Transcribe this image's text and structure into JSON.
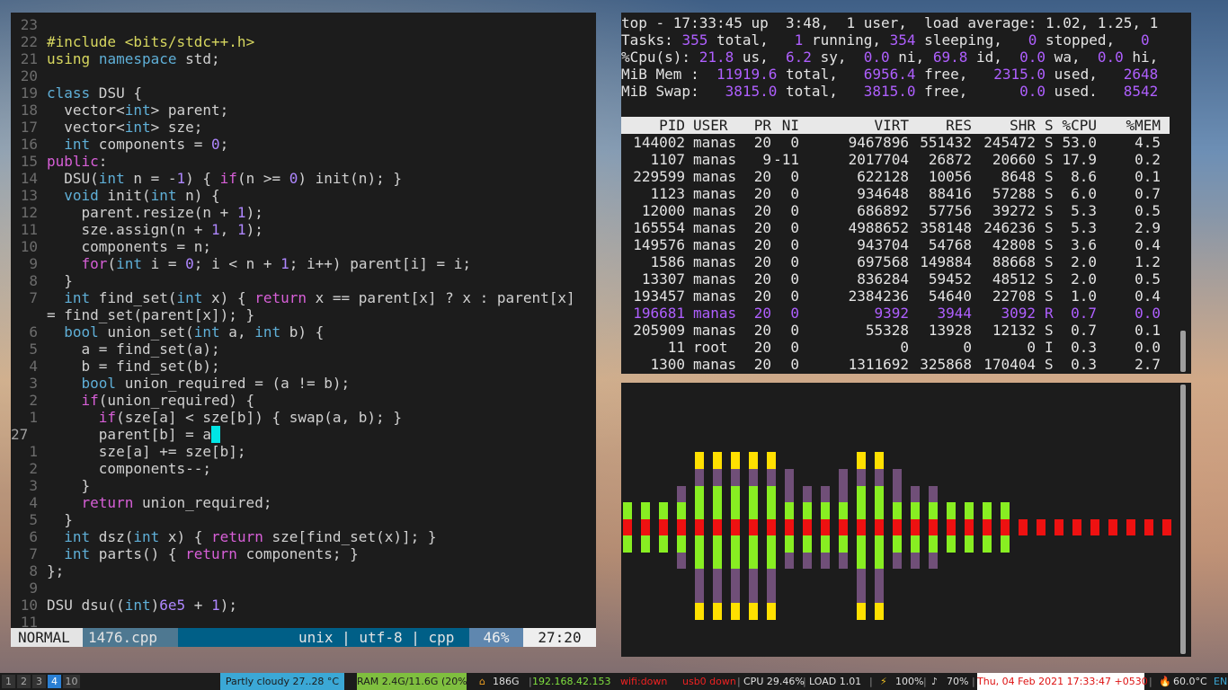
{
  "vim": {
    "lines": [
      {
        "n": "23",
        "t": ""
      },
      {
        "n": "22",
        "t": "<span class='pre'>#include</span> <span class='str'>&lt;bits/stdc++.h&gt;</span>"
      },
      {
        "n": "21",
        "t": "<span class='pre'>using</span> <span class='ty'>namespace</span> std;"
      },
      {
        "n": "20",
        "t": ""
      },
      {
        "n": "19",
        "t": "<span class='ty'>class</span> DSU {"
      },
      {
        "n": "18",
        "t": "  vector&lt;<span class='ty'>int</span>&gt; parent;"
      },
      {
        "n": "17",
        "t": "  vector&lt;<span class='ty'>int</span>&gt; sze;"
      },
      {
        "n": "16",
        "t": "  <span class='ty'>int</span> components = <span class='num'>0</span>;"
      },
      {
        "n": "15",
        "t": "<span class='kw'>public</span>:"
      },
      {
        "n": "14",
        "t": "  DSU(<span class='ty'>int</span> n = -<span class='num'>1</span>) { <span class='kw'>if</span>(n &gt;= <span class='num'>0</span>) init(n); }"
      },
      {
        "n": "13",
        "t": "  <span class='ty'>void</span> init(<span class='ty'>int</span> n) {"
      },
      {
        "n": "12",
        "t": "    parent.resize(n + <span class='num'>1</span>);"
      },
      {
        "n": "11",
        "t": "    sze.assign(n + <span class='num'>1</span>, <span class='num'>1</span>);"
      },
      {
        "n": "10",
        "t": "    components = n;"
      },
      {
        "n": "9",
        "t": "    <span class='kw'>for</span>(<span class='ty'>int</span> i = <span class='num'>0</span>; i &lt; n + <span class='num'>1</span>; i++) parent[i] = i;"
      },
      {
        "n": "8",
        "t": "  }"
      },
      {
        "n": "7",
        "t": "  <span class='ty'>int</span> find_set(<span class='ty'>int</span> x) { <span class='kw'>return</span> x == parent[x] ? x : parent[x]"
      },
      {
        "n": "",
        "t": "= find_set(parent[x]); }"
      },
      {
        "n": "6",
        "t": "  <span class='ty'>bool</span> union_set(<span class='ty'>int</span> a, <span class='ty'>int</span> b) {"
      },
      {
        "n": "5",
        "t": "    a = find_set(a);"
      },
      {
        "n": "4",
        "t": "    b = find_set(b);"
      },
      {
        "n": "3",
        "t": "    <span class='ty'>bool</span> union_required = (a != b);"
      },
      {
        "n": "2",
        "t": "    <span class='kw'>if</span>(union_required) {"
      },
      {
        "n": "1",
        "t": "      <span class='kw'>if</span>(sze[a] &lt; sze[b]) { swap(a, b); }"
      },
      {
        "n": "27",
        "t": "      parent[b] = a<span class='cursor'> </span>",
        "cur": true
      },
      {
        "n": "1",
        "t": "      sze[a] += sze[b];"
      },
      {
        "n": "2",
        "t": "      components--;"
      },
      {
        "n": "3",
        "t": "    }"
      },
      {
        "n": "4",
        "t": "    <span class='kw'>return</span> union_required;"
      },
      {
        "n": "5",
        "t": "  }"
      },
      {
        "n": "6",
        "t": "  <span class='ty'>int</span> dsz(<span class='ty'>int</span> x) { <span class='kw'>return</span> sze[find_set(x)]; }"
      },
      {
        "n": "7",
        "t": "  <span class='ty'>int</span> parts() { <span class='kw'>return</span> components; }"
      },
      {
        "n": "8",
        "t": "};"
      },
      {
        "n": "9",
        "t": ""
      },
      {
        "n": "10",
        "t": "DSU dsu((<span class='ty'>int</span>)<span class='num'>6e5</span> + <span class='num'>1</span>);"
      },
      {
        "n": "11",
        "t": ""
      }
    ],
    "status": {
      "mode": "NORMAL",
      "file": "1476.cpp",
      "fileinfo": "unix | utf-8 | cpp",
      "percent": "46%",
      "position": "27:20"
    }
  },
  "top": {
    "summary": [
      "top - 17:33:45 up  3:48,  1 user,  load average: 1.02, 1.25, 1",
      "Tasks: <v>355</v> total,   <v>1</v> running, <v>354</v> sleeping,   <v>0</v> stopped,   <v>0</v>",
      "%Cpu(s): <v>21.8</v> us,  <v>6.2</v> sy,  <v>0.0</v> ni, <v>69.8</v> id,  <v>0.0</v> wa,  <v>0.0</v> hi,",
      "MiB Mem :  <v>11919.6</v> total,   <v>6956.4</v> free,   <v>2315.0</v> used,   <v>2648</v>",
      "MiB Swap:   <v>3815.0</v> total,   <v>3815.0</v> free,      <v>0.0</v> used.   <v>8542</v>"
    ],
    "headers": [
      "PID",
      "USER",
      "PR",
      "NI",
      "VIRT",
      "RES",
      "SHR",
      "S",
      "%CPU",
      "%MEM"
    ],
    "rows": [
      [
        "144002",
        "manas",
        "20",
        "0",
        "9467896",
        "551432",
        "245472",
        "S",
        "53.0",
        "4.5"
      ],
      [
        "1107",
        "manas",
        "9",
        "-11",
        "2017704",
        "26872",
        "20660",
        "S",
        "17.9",
        "0.2"
      ],
      [
        "229599",
        "manas",
        "20",
        "0",
        "622128",
        "10056",
        "8648",
        "S",
        "8.6",
        "0.1"
      ],
      [
        "1123",
        "manas",
        "20",
        "0",
        "934648",
        "88416",
        "57288",
        "S",
        "6.0",
        "0.7"
      ],
      [
        "12000",
        "manas",
        "20",
        "0",
        "686892",
        "57756",
        "39272",
        "S",
        "5.3",
        "0.5"
      ],
      [
        "165554",
        "manas",
        "20",
        "0",
        "4988652",
        "358148",
        "246236",
        "S",
        "5.3",
        "2.9"
      ],
      [
        "149576",
        "manas",
        "20",
        "0",
        "943704",
        "54768",
        "42808",
        "S",
        "3.6",
        "0.4"
      ],
      [
        "1586",
        "manas",
        "20",
        "0",
        "697568",
        "149884",
        "88668",
        "S",
        "2.0",
        "1.2"
      ],
      [
        "13307",
        "manas",
        "20",
        "0",
        "836284",
        "59452",
        "48512",
        "S",
        "2.0",
        "0.5"
      ],
      [
        "193457",
        "manas",
        "20",
        "0",
        "2384236",
        "54640",
        "22708",
        "S",
        "1.0",
        "0.4"
      ],
      [
        "196681",
        "manas",
        "20",
        "0",
        "9392",
        "3944",
        "3092",
        "R",
        "0.7",
        "0.0"
      ],
      [
        "205909",
        "manas",
        "20",
        "0",
        "55328",
        "13928",
        "12132",
        "S",
        "0.7",
        "0.1"
      ],
      [
        "11",
        "root",
        "20",
        "0",
        "0",
        "0",
        "0",
        "I",
        "0.3",
        "0.0"
      ],
      [
        "1300",
        "manas",
        "20",
        "0",
        "1311692",
        "325868",
        "170404",
        "S",
        "0.3",
        "2.7"
      ]
    ],
    "highlight_row": 10
  },
  "visualizer": {
    "bar_levels": [
      2,
      2,
      2,
      3,
      5,
      5,
      5,
      5,
      5,
      4,
      3,
      3,
      4,
      5,
      5,
      4,
      3,
      3,
      2,
      2,
      2,
      2,
      1,
      1,
      1,
      1,
      1,
      1,
      1,
      1,
      1
    ],
    "colors": {
      "red": "#ee1111",
      "green": "#88ee22",
      "purple": "#704f78",
      "yellow": "#ffe000"
    }
  },
  "statusbar": {
    "workspaces": [
      "1",
      "2",
      "3",
      "4",
      "10"
    ],
    "active_workspace": "4",
    "weather": "Partly cloudy 27..28 °C",
    "ram": "RAM 2.4G/11.6G (20%)",
    "disk": "186G",
    "ip": "192.168.42.153",
    "wifi": "wifi:down",
    "usb": "usb0 down",
    "cpu": "CPU 29.46%",
    "load": "LOAD 1.01",
    "battery": "100%",
    "volume": "70%",
    "datetime": "Thu, 04 Feb 2021 17:33:47 +0530",
    "temp": "60.0°C",
    "lang": "EN"
  }
}
